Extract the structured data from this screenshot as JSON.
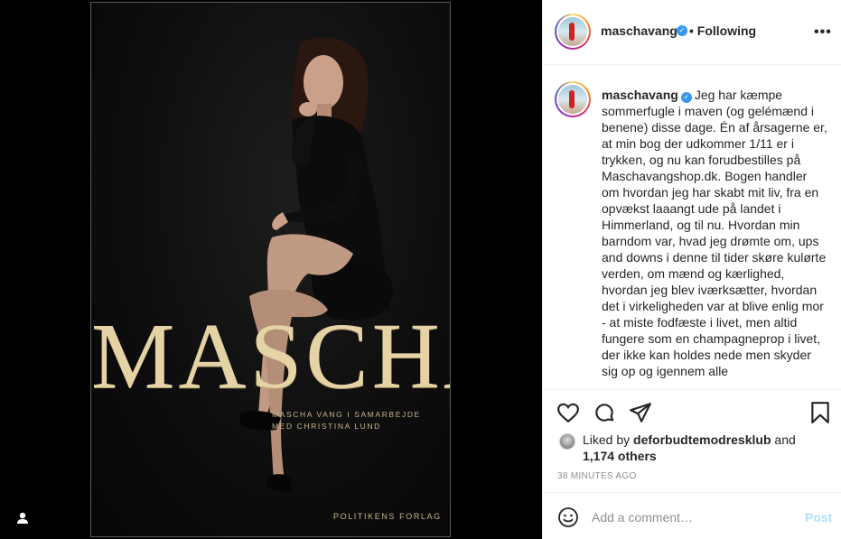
{
  "post": {
    "username": "maschavang",
    "follow_status": "• Following",
    "more_label": "•••",
    "caption_username": "maschavang",
    "caption_text": "Jeg har kæmpe sommerfugle i maven (og gelémænd i benene) disse dage. Én af årsagerne er, at min bog der udkommer 1/11 er i trykken, og nu kan forudbestilles på Maschavangshop.dk. Bogen handler om hvordan jeg har skabt mit liv, fra en opvækst laaangt ude på landet i Himmerland, og til nu. Hvordan min barndom var, hvad jeg drømte om, ups and downs i denne til tider skøre kulørte verden, om mænd og kærlighed, hvordan jeg blev iværksætter, hvordan det i virkeligheden var at blive enlig mor - at miste fodfæste i livet, men altid fungere som en champagneprop i livet, der ikke kan holdes nede men skyder sig op og igennem alle",
    "liked_by_prefix": "Liked by",
    "liked_by_user": "deforbudtemodresklub",
    "liked_by_and": "and",
    "others_count": "1,174 others",
    "timestamp": "38 MINUTES AGO",
    "comment_placeholder": "Add a comment…",
    "post_label": "Post"
  },
  "cover": {
    "title": "MASCHA",
    "subtitle_line1": "MASCHA VANG I SAMARBEJDE",
    "subtitle_line2": "MED CHRISTINA LUND",
    "publisher": "POLITIKENS FORLAG"
  },
  "icons": {
    "verified": "verified-badge-icon",
    "like": "heart-icon",
    "comment": "comment-icon",
    "share": "paper-plane-icon",
    "save": "bookmark-icon",
    "emoji": "smiley-icon",
    "user": "user-icon"
  },
  "colors": {
    "link_blue": "#3897f0",
    "post_disabled": "#b2dffc",
    "gold": "#e5d3a6",
    "muted": "#8e8e8e"
  }
}
